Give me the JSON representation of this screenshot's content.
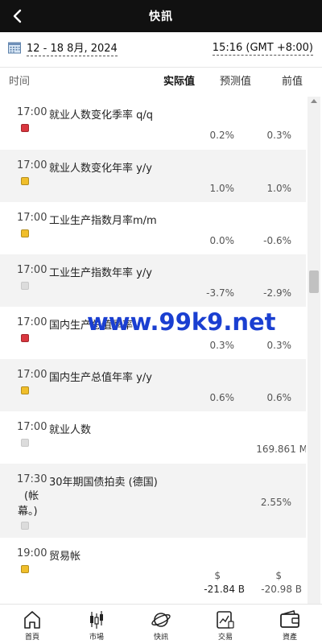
{
  "header": {
    "title": "快訊"
  },
  "datebar": {
    "date_range": "12 - 18 8月, 2024",
    "timezone": "15:16 (GMT +8:00)"
  },
  "columns": {
    "time": "时间",
    "actual": "实际值",
    "forecast": "预测值",
    "previous": "前值"
  },
  "rows": [
    {
      "time": "17:00",
      "name": "就业人数变化季率 q/q",
      "importance": "high",
      "actual": "",
      "forecast": "0.2%",
      "previous": "0.3%"
    },
    {
      "time": "17:00",
      "name": "就业人数变化年率 y/y",
      "importance": "medium",
      "actual": "",
      "forecast": "1.0%",
      "previous": "1.0%"
    },
    {
      "time": "17:00",
      "name": "工业生产指数月率m/m",
      "importance": "medium",
      "actual": "",
      "forecast": "0.0%",
      "previous": "-0.6%"
    },
    {
      "time": "17:00",
      "name": "工业生产指数年率 y/y",
      "importance": "low",
      "actual": "",
      "forecast": "-3.7%",
      "previous": "-2.9%"
    },
    {
      "time": "17:00",
      "name": "国内生产总值季率",
      "importance": "high",
      "actual": "",
      "forecast": "0.3%",
      "previous": "0.3%"
    },
    {
      "time": "17:00",
      "name": "国内生产总值年率 y/y",
      "importance": "medium",
      "actual": "",
      "forecast": "0.6%",
      "previous": "0.6%"
    },
    {
      "time": "17:00",
      "name": "就业人数",
      "importance": "low",
      "actual": "",
      "forecast": "",
      "previous": "169.861 M"
    },
    {
      "time": "17:30",
      "name": "30年期国债拍卖 (德国)",
      "name_line2": "(帐",
      "name_line3": "幕。)",
      "importance": "low",
      "actual": "",
      "forecast": "",
      "previous": "2.55%"
    },
    {
      "time": "19:00",
      "name": "贸易帐",
      "importance": "medium",
      "actual": "",
      "forecast_currency": "$",
      "forecast": "-21.84 B",
      "previous_currency": "$",
      "previous": "-20.98 B"
    }
  ],
  "watermark": "www.99k9.net",
  "bottom_nav": [
    {
      "label": "首頁",
      "icon": "home-icon"
    },
    {
      "label": "市場",
      "icon": "candlestick-icon"
    },
    {
      "label": "快訊",
      "icon": "planet-icon"
    },
    {
      "label": "交易",
      "icon": "trade-chart-icon"
    },
    {
      "label": "資產",
      "icon": "wallet-icon"
    }
  ],
  "colors": {
    "header_bg": "#111111",
    "high": "#d9363e",
    "medium": "#f0be2a",
    "low": "#dcdcdc",
    "row_alt": "#f3f3f3",
    "watermark": "#1a3fd1"
  }
}
